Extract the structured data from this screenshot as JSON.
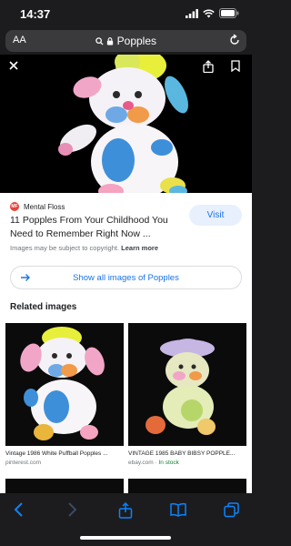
{
  "status": {
    "time": "14:37"
  },
  "url_bar": {
    "text_size_label": "AA",
    "site": "Popples"
  },
  "result": {
    "source_name": "Mental Floss",
    "source_logo_text": "MF",
    "visit_label": "Visit",
    "title": "11 Popples From Your Childhood You Need to Remember Right Now ...",
    "copyright_text": "Images may be subject to copyright.",
    "learn_more": "Learn more",
    "show_all_label": "Show all images of Popples"
  },
  "related": {
    "heading": "Related images",
    "items": [
      {
        "caption": "Vintage 1986 White Puffball Popples ...",
        "site": "pinterest.com",
        "stock": ""
      },
      {
        "caption": "VINTAGE 1985 BABY BIBSY POPPLE...",
        "site": "ebay.com",
        "stock": "In stock"
      }
    ]
  },
  "colors": {
    "accent": "#1a73e8",
    "visit_bg": "#e8f0fe",
    "toolbar": "#1c1c1e",
    "stock": "#188038"
  }
}
